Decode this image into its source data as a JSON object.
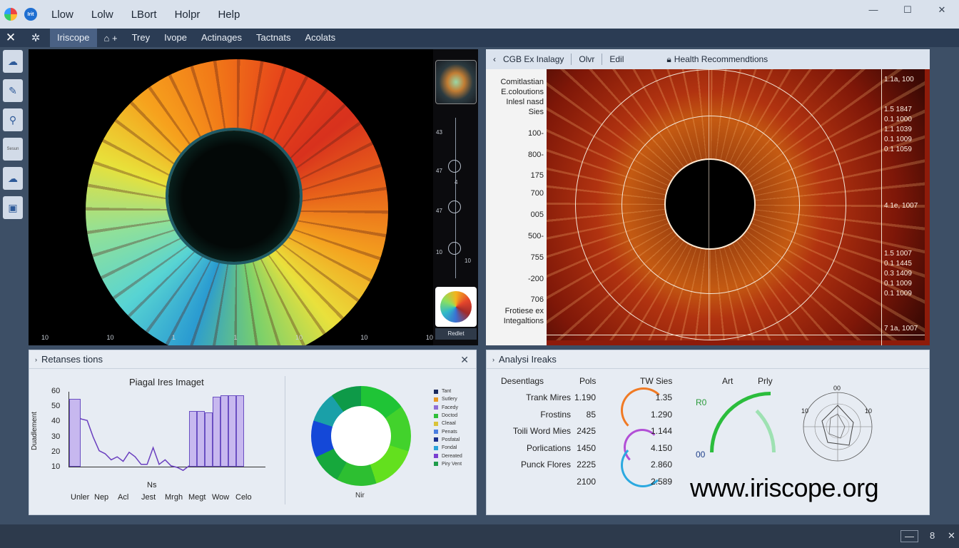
{
  "titlebar": {
    "badge": "Irit",
    "menu": [
      "Llow",
      "Lolw",
      "LBort",
      "Holpr",
      "Help"
    ],
    "controls": [
      "—",
      "☐",
      "✕"
    ]
  },
  "tabbar": {
    "tabs": [
      "Iriscope",
      "Trey",
      "Ivope",
      "Actinages",
      "Tactnats",
      "Acolats"
    ]
  },
  "lefttools": {
    "label_small": "Sesun"
  },
  "iris_view": {
    "axis_ticks": [
      "10",
      "10",
      "1",
      "1",
      "10",
      "10",
      "10"
    ]
  },
  "side_strip": {
    "labels": [
      "43",
      "47",
      "4",
      "47",
      "10",
      "10"
    ],
    "button": "Redlet"
  },
  "right_panel": {
    "header": {
      "title": "CGB Ex Inalagy",
      "item2": "Olvr",
      "item3": "Edil",
      "item4": "Health Recommendtions"
    },
    "left_labels": [
      "Comitlastian",
      "E.coloutions",
      "Inlesl nasd",
      "Sies",
      "100-",
      "800-",
      "175",
      "700",
      "005",
      "500-",
      "755",
      "-200",
      "706",
      "Frotiese ex",
      "Integaltions"
    ],
    "right_labels": [
      "1.1a, 100",
      "1.5 1847",
      "0.1 1000",
      "1.1 1039",
      "0.1 1009",
      "0.1 1059",
      "4.1e, 1007",
      "1.5 1007",
      "0.1 1445",
      "0.3 1409",
      "0.1 1009",
      "0.1 1009",
      "7 1a, 1007"
    ]
  },
  "bottom_left": {
    "header": "Retanses tions",
    "chart_title": "Piagal Ires Imaget",
    "ylabel": "Duadlement",
    "xlabel": "Ns",
    "donut_label": "Nir",
    "legend": [
      "Tant",
      "Sutlery",
      "Facedy",
      "Doctod",
      "Cleaal",
      "Penats",
      "Posfatal",
      "Fondal",
      "Dereated",
      "Piry Vent"
    ]
  },
  "chart_data": {
    "type": "bar",
    "title": "Piagal Ires Imaget",
    "xlabel": "Ns",
    "ylabel": "Duadlement",
    "categories": [
      "Unler",
      "Nep",
      "Acl",
      "Jest",
      "Mrgh",
      "Megt",
      "Wow",
      "Celo"
    ],
    "y_ticks": [
      10,
      20,
      30,
      40,
      50,
      60
    ],
    "ylim": [
      10,
      60
    ],
    "bar_values": [
      47,
      47,
      46,
      56,
      57,
      57,
      57
    ],
    "line_values": [
      55,
      45,
      42,
      41,
      30,
      21,
      19,
      15,
      17,
      14,
      20,
      17,
      12,
      12,
      23,
      12,
      15,
      11,
      10,
      8,
      11
    ],
    "grid": false
  },
  "bottom_right": {
    "header": "Analysi Ireaks",
    "cols": [
      "Desentlags",
      "Pols",
      "TW",
      "Sies",
      "Art",
      "Prly"
    ],
    "rows": [
      {
        "label": "Trank Mires",
        "v1": "1.190",
        "v2": "1.35"
      },
      {
        "label": "Frostins",
        "v1": "85",
        "v2": "1.290"
      },
      {
        "label": "Toili Word Mies",
        "v1": "2425",
        "v2": "1.144"
      },
      {
        "label": "Porlications",
        "v1": "1450",
        "v2": "4.150"
      },
      {
        "label": "Punck Flores",
        "v1": "2225",
        "v2": "2.860"
      },
      {
        "label": "",
        "v1": "2100",
        "v2": "2.589"
      }
    ],
    "gauge_labels": [
      "R0",
      "00"
    ],
    "radar_labels": [
      "00",
      "10",
      "10"
    ],
    "watermark": "www.iriscope.org"
  },
  "statusbar": {
    "items": [
      "—",
      "8",
      "✕"
    ]
  },
  "colors": {
    "accent": "#1f6fd1",
    "frame": "#3d4f66",
    "bars": "#c7b8ef",
    "line": "#6a3fbf"
  }
}
